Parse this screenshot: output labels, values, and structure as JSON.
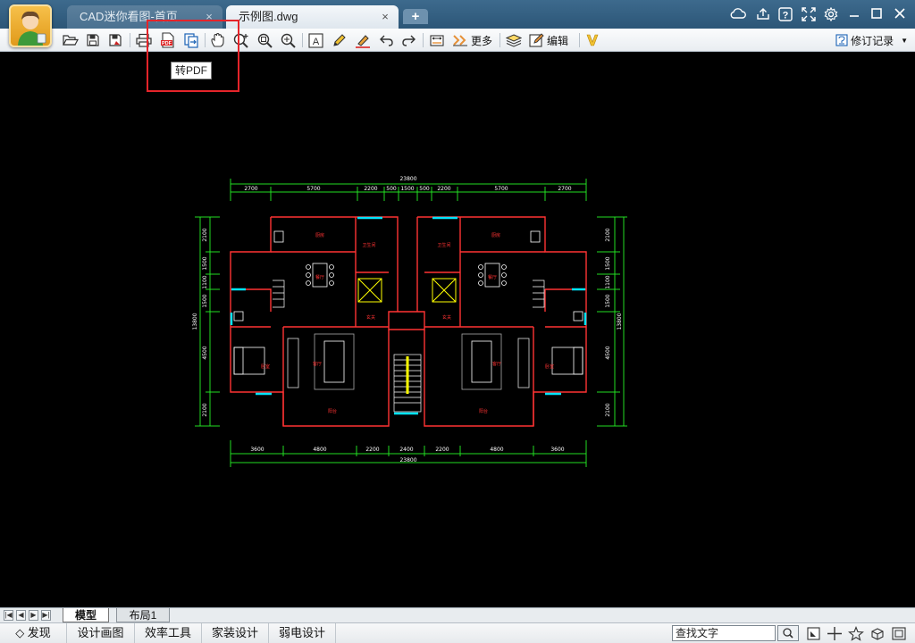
{
  "tabs": [
    {
      "label": "CAD迷你看图-首页",
      "close": "×",
      "active": false
    },
    {
      "label": "示例图.dwg",
      "close": "×",
      "active": true
    }
  ],
  "new_tab_label": "+",
  "toolbar": {
    "more_label": "更多",
    "edit_label": "编辑",
    "revision_label": "修订记录",
    "revision_arrow": "▼"
  },
  "tooltip": "转PDF",
  "layout_tabs": [
    "模型",
    "布局1"
  ],
  "status_bar": {
    "items": [
      "◇ 发现",
      "设计画图",
      "效率工具",
      "家装设计",
      "弱电设计"
    ],
    "search_text": "查找文字"
  },
  "drawing": {
    "overall_top": "23800",
    "top_dims": [
      "2700",
      "5700",
      "2200",
      "500",
      "1500",
      "500",
      "2200",
      "5700",
      "2700"
    ],
    "overall_bottom": "23800",
    "bottom_dims": [
      "3600",
      "4800",
      "2200",
      "2400",
      "2200",
      "4800",
      "3600"
    ],
    "left_dims": [
      "2100",
      "1500",
      "1100",
      "1500",
      "4500",
      "2100"
    ],
    "right_dims": [
      "2100",
      "1500",
      "1100",
      "1500",
      "4500",
      "2100"
    ],
    "overall_side": "13800",
    "rooms": [
      "厨房",
      "厨房",
      "餐厅",
      "餐厅",
      "客厅",
      "客厅",
      "卧室",
      "卧室",
      "阳台",
      "阳台",
      "玄关",
      "玄关",
      "卫生间",
      "卫生间"
    ]
  },
  "colors": {
    "titlebar": "#2c5677",
    "highlight": "#e5242a",
    "canvas": "#000000",
    "wall": "#ff3333",
    "dimension": "#22dd22",
    "window": "#00e5ff",
    "furniture": "#ffffff",
    "stair": "#ffff00"
  }
}
